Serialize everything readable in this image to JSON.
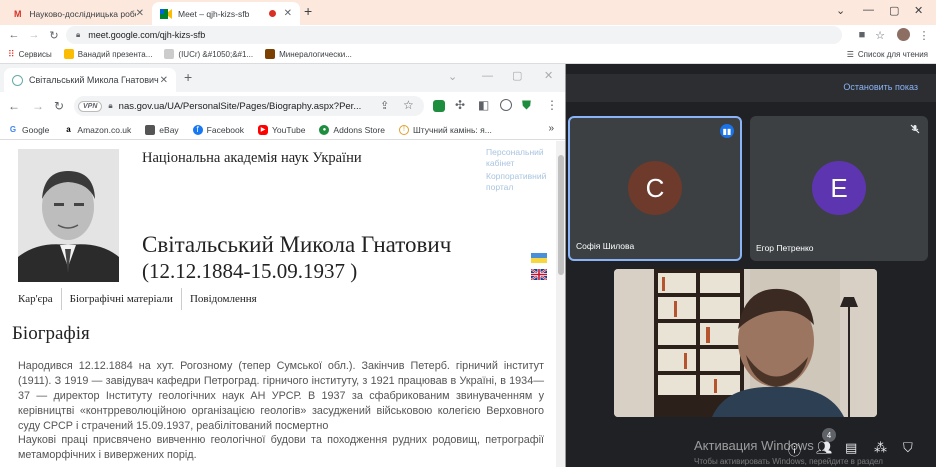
{
  "outer_browser": {
    "tabs": [
      {
        "title": "Науково-дослідницька робота",
        "icon": "gmail-icon"
      },
      {
        "title": "Meet – qjh-kizs-sfb",
        "icon": "meet-icon"
      }
    ],
    "url": "meet.google.com/qjh-kizs-sfb",
    "bookmarks": [
      "Сервисы",
      "Ванадий презента...",
      "(IUCr) &#1050;&#1...",
      "Минералогически..."
    ],
    "reading_list": "Список для чтения"
  },
  "meet": {
    "stop_share": "Остановить показ",
    "participants": [
      {
        "initial": "С",
        "name": "Софія Шилова",
        "color": "#6d3a2c",
        "state": "speaking"
      },
      {
        "initial": "Е",
        "name": "Егор Петренко",
        "color": "#5e35b1",
        "state": "muted"
      }
    ],
    "people_count": "4",
    "activation_title": "Активация Windows",
    "activation_sub": "Чтобы активировать Windows, перейдите в раздел"
  },
  "inner_browser": {
    "tab_title": "Світальський Микола Гнатович",
    "vpn": "VPN",
    "url": "nas.gov.ua/UA/PersonalSite/Pages/Biography.aspx?Per...",
    "bookmarks": [
      "Google",
      "Amazon.co.uk",
      "eBay",
      "Facebook",
      "YouTube",
      "Addons Store",
      "Штучний камінь: я..."
    ]
  },
  "page": {
    "academy": "Національна академія наук України",
    "side_links": [
      "Персональний кабінет",
      "Корпоративний портал"
    ],
    "name": "Світальський Микола Гнатович",
    "dates": "(12.12.1884-15.09.1937 )",
    "tabs": [
      "Кар'єра",
      "Біографічні матеріали",
      "Повідомлення"
    ],
    "heading": "Біографія",
    "paragraph1": "Народився 12.12.1884 на хут. Рогозному (тепер Сумської обл.). Закінчив Петерб. гірничий інститут (1911). З 1919 — завідувач кафедри Петроград. гірничого інституту, з 1921 працював в Україні, в 1934—37 — директор Інституту геологічних наук АН УРСР. В 1937 за сфабрикованим звинуваченням у керівництві «контрреволюційною організацією геологів» засуджений військовою колегією Верховного суду СРСР і страчений 15.09.1937, реабілітований посмертно",
    "paragraph2": "Наукові праці присвячено вивченню геологічної будови та походження рудних родовищ, петрографії метаморфічних і вивержених порід."
  }
}
